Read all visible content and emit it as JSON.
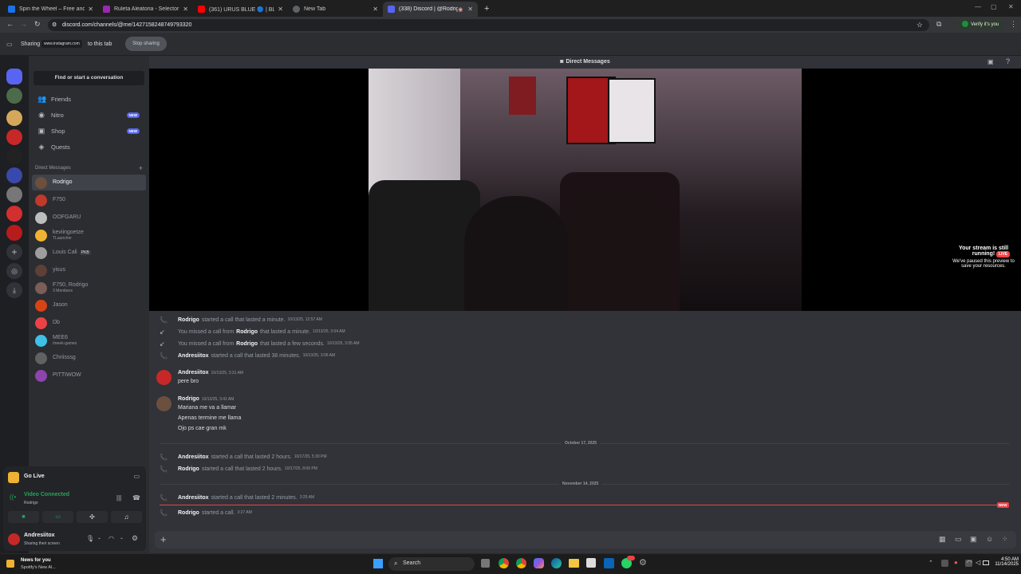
{
  "browser": {
    "tabs": [
      {
        "title": "Spin the Wheel – Free and easy",
        "color": "#1a73e8"
      },
      {
        "title": "Ruleta Aleatoria - Selector Pers",
        "color": "#9c27b0"
      },
      {
        "title": "(361) URUS BLUE 🔵 | BLESSD",
        "color": "#ff0000"
      },
      {
        "title": "New Tab",
        "color": "#888888"
      },
      {
        "title": "(338) Discord | @Rodrigo",
        "color": "#5865f2"
      }
    ],
    "url": "discord.com/channels/@me/1427158248749793320",
    "profile_label": "Verify it's you"
  },
  "sharebar": {
    "prefix": "Sharing",
    "site": "www.instagram.com",
    "suffix": "to this tab",
    "stop_label": "Stop sharing"
  },
  "sidebar": {
    "search_label": "Find or start a conversation",
    "nav": [
      {
        "label": "Friends",
        "icon": "friends-icon",
        "badge": ""
      },
      {
        "label": "Nitro",
        "icon": "nitro-icon",
        "badge": "NEW"
      },
      {
        "label": "Shop",
        "icon": "shop-icon",
        "badge": "NEW"
      },
      {
        "label": "Quests",
        "icon": "quests-icon",
        "badge": ""
      }
    ],
    "dm_header": "Direct Messages",
    "dms": [
      {
        "name": "Rodrigo",
        "sub": "",
        "color": "#6b4f3f"
      },
      {
        "name": "F750",
        "sub": "",
        "color": "#c0392b"
      },
      {
        "name": "OOFGARU",
        "sub": "",
        "color": "#bdbdbd"
      },
      {
        "name": "keviingoetze",
        "sub": "TLauncher",
        "color": "#f0b232"
      },
      {
        "name": "Louis Cali",
        "sub": "",
        "tag": "PKB",
        "color": "#9e9e9e"
      },
      {
        "name": "yisus",
        "sub": "",
        "color": "#5d4037"
      },
      {
        "name": "F750, Rodrigo",
        "sub": "3 Members",
        "color": "#7b5e57"
      },
      {
        "name": "Jason",
        "sub": "",
        "color": "#d84315"
      },
      {
        "name": "Db",
        "sub": "",
        "color": "#ed4245"
      },
      {
        "name": "MEE6",
        "sub": "/meek-games",
        "color": "#3fc1e6"
      },
      {
        "name": "Chriisssg",
        "sub": "",
        "color": "#616161"
      },
      {
        "name": "PITTIWOW",
        "sub": "",
        "color": "#8e44ad"
      }
    ]
  },
  "panel": {
    "go_live": "Go Live",
    "video_connected": "Video Connected",
    "video_channel": "Rodrigo",
    "user_name": "Andresiitox",
    "user_status": "Sharing their screen"
  },
  "main": {
    "header_title": "Direct Messages",
    "stream_notice_title": "Your stream is still running!",
    "stream_notice_body": "We've paused this preview to save your resources.",
    "live_badge": "LIVE",
    "system_messages_top": [
      {
        "kind": "call",
        "author": "Rodrigo",
        "text": "started a call that lasted a minute.",
        "ts": "10/13/25, 12:57 AM"
      },
      {
        "kind": "missed",
        "author": "",
        "text_pre": "You missed a call from",
        "author2": "Rodrigo",
        "text": "that lasted a minute.",
        "ts": "10/13/25, 3:04 AM"
      },
      {
        "kind": "missed",
        "author": "",
        "text_pre": "You missed a call from",
        "author2": "Rodrigo",
        "text": "that lasted a few seconds.",
        "ts": "10/13/25, 3:05 AM"
      },
      {
        "kind": "call",
        "author": "Andresiitox",
        "text": "started a call that lasted 38 minutes.",
        "ts": "10/13/25, 3:06 AM"
      }
    ],
    "msg1": {
      "author": "Andresiitox",
      "ts": "10/13/25, 3:31 AM",
      "lines": [
        "pere bro"
      ]
    },
    "msg2": {
      "author": "Rodrigo",
      "ts": "10/13/25, 3:41 AM",
      "lines": [
        "Mariana me va a llamar",
        "Apenas termine me llama",
        "Ojo ps cae gran mk"
      ]
    },
    "date1": "October 17, 2025",
    "calls_mid": [
      {
        "author": "Andresiitox",
        "text": "started a call that lasted 2 hours.",
        "ts": "10/17/25, 5:30 PM"
      },
      {
        "author": "Rodrigo",
        "text": "started a call that lasted 2 hours.",
        "ts": "10/17/25, 8:06 PM"
      }
    ],
    "date2": "November 14, 2025",
    "calls_bottom": [
      {
        "author": "Andresiitox",
        "text": "started a call that lasted 2 minutes.",
        "ts": "3:25 AM"
      },
      {
        "author": "Rodrigo",
        "text": "started a call.",
        "ts": "3:27 AM"
      }
    ],
    "new_label": "NEW"
  },
  "taskbar": {
    "news_title": "News for you",
    "news_sub": "Spotify's New Al...",
    "search_label": "Search",
    "time": "4:50 AM",
    "date": "11/14/2025"
  },
  "colors": {
    "accent": "#5865f2",
    "green": "#23a55a",
    "red": "#ed4245"
  }
}
